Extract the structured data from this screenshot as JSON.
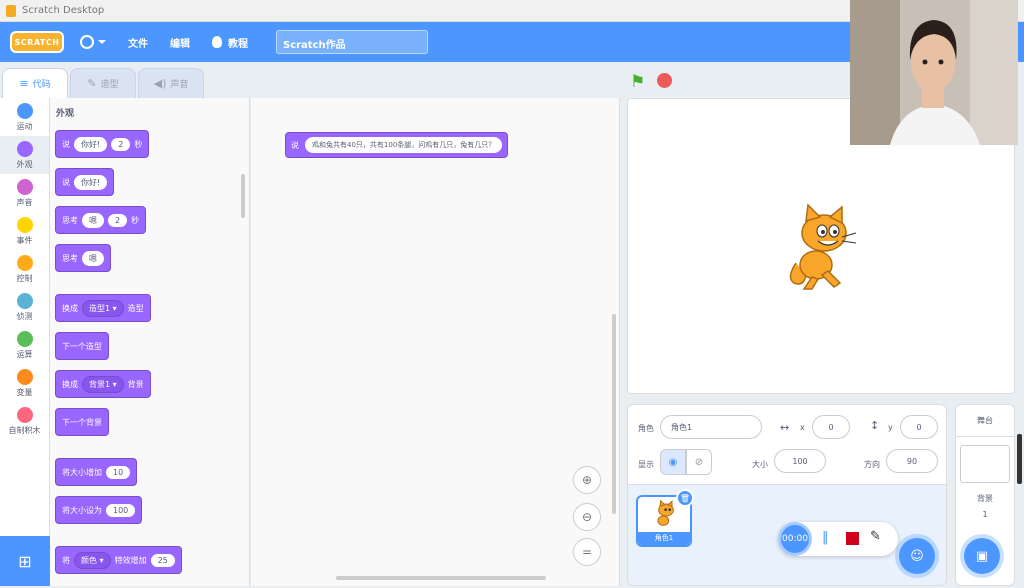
{
  "window": {
    "title": "Scratch Desktop"
  },
  "menubar": {
    "logo": "SCRATCH",
    "file": "文件",
    "edit": "编辑",
    "tutorials": "教程",
    "project_title": "Scratch作品"
  },
  "tabs": [
    {
      "label": "代码",
      "icon": "code-icon"
    },
    {
      "label": "造型",
      "icon": "brush-icon"
    },
    {
      "label": "声音",
      "icon": "speaker-icon"
    }
  ],
  "categories": [
    {
      "label": "运动",
      "color": "#4c97ff"
    },
    {
      "label": "外观",
      "color": "#9966ff"
    },
    {
      "label": "声音",
      "color": "#cf63cf"
    },
    {
      "label": "事件",
      "color": "#ffd500"
    },
    {
      "label": "控制",
      "color": "#ffab19"
    },
    {
      "label": "侦测",
      "color": "#5cb1d6"
    },
    {
      "label": "运算",
      "color": "#59c059"
    },
    {
      "label": "变量",
      "color": "#ff8c1a"
    },
    {
      "label": "自制积木",
      "color": "#ff6680"
    }
  ],
  "palette": {
    "title": "外观",
    "say_for": {
      "say": "说",
      "text": "你好!",
      "secs": "2",
      "unit": "秒"
    },
    "say": {
      "say": "说",
      "text": "你好!"
    },
    "think_for": {
      "think": "思考",
      "text": "嗯",
      "secs": "2",
      "unit": "秒"
    },
    "think": {
      "think": "思考",
      "text": "嗯"
    },
    "switch_costume": {
      "prefix": "换成",
      "value": "造型1",
      "suffix": "造型"
    },
    "next_costume": "下一个造型",
    "switch_backdrop": {
      "prefix": "换成",
      "value": "背景1",
      "suffix": "背景"
    },
    "next_backdrop": "下一个背景",
    "change_size": {
      "text": "将大小增加",
      "value": "10"
    },
    "set_size": {
      "text": "将大小设为",
      "value": "100"
    },
    "change_effect": {
      "prefix": "将",
      "effect": "颜色",
      "middle": "特效增加",
      "value": "25"
    }
  },
  "workspace": {
    "block": {
      "say": "说",
      "text": "鸡和兔共有40只，共有100条腿，问鸡有几只，兔有几只？"
    }
  },
  "sprite_info": {
    "sprite_label": "角色",
    "sprite_name": "角色1",
    "x_label": "x",
    "x_value": "0",
    "y_label": "y",
    "y_value": "0",
    "show_label": "显示",
    "size_label": "大小",
    "size_value": "100",
    "direction_label": "方向",
    "direction_value": "90"
  },
  "sprite_list": [
    {
      "name": "角色1"
    }
  ],
  "stage_target": {
    "title": "舞台",
    "backdrop_label": "背景",
    "backdrop_count": "1"
  },
  "recorder": {
    "time": "00:00"
  }
}
